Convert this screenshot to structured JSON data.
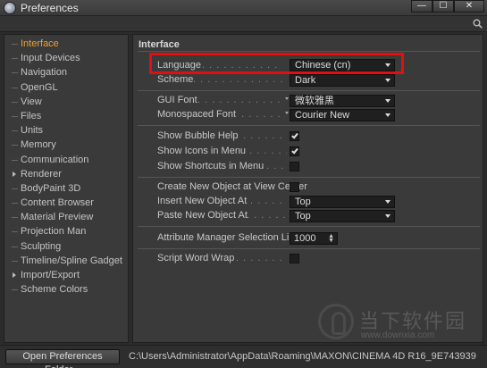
{
  "window": {
    "title": "Preferences",
    "controls": {
      "minimize": "—",
      "maximize": "☐",
      "close": "✕"
    }
  },
  "sidebar": {
    "items": [
      {
        "label": "Interface",
        "active": true,
        "expandable": false
      },
      {
        "label": "Input Devices",
        "active": false,
        "expandable": false
      },
      {
        "label": "Navigation",
        "active": false,
        "expandable": false
      },
      {
        "label": "OpenGL",
        "active": false,
        "expandable": false
      },
      {
        "label": "View",
        "active": false,
        "expandable": false
      },
      {
        "label": "Files",
        "active": false,
        "expandable": false
      },
      {
        "label": "Units",
        "active": false,
        "expandable": false
      },
      {
        "label": "Memory",
        "active": false,
        "expandable": false
      },
      {
        "label": "Communication",
        "active": false,
        "expandable": false
      },
      {
        "label": "Renderer",
        "active": false,
        "expandable": true
      },
      {
        "label": "BodyPaint 3D",
        "active": false,
        "expandable": false
      },
      {
        "label": "Content Browser",
        "active": false,
        "expandable": false
      },
      {
        "label": "Material Preview",
        "active": false,
        "expandable": false
      },
      {
        "label": "Projection Man",
        "active": false,
        "expandable": false
      },
      {
        "label": "Sculpting",
        "active": false,
        "expandable": false
      },
      {
        "label": "Timeline/Spline Gadget",
        "active": false,
        "expandable": false
      },
      {
        "label": "Import/Export",
        "active": false,
        "expandable": true
      },
      {
        "label": "Scheme Colors",
        "active": false,
        "expandable": false
      }
    ]
  },
  "main": {
    "section_title": "Interface",
    "language": {
      "label": "Language",
      "value": "Chinese (cn)"
    },
    "scheme": {
      "label": "Scheme",
      "value": "Dark"
    },
    "gui_font": {
      "label": "GUI Font",
      "value": "微软雅黑"
    },
    "mono_font": {
      "label": "Monospaced Font",
      "value": "Courier New"
    },
    "show_bubble_help": {
      "label": "Show Bubble Help",
      "checked": true
    },
    "show_icons_in_menu": {
      "label": "Show Icons in Menu",
      "checked": true
    },
    "show_shortcuts_in_menu": {
      "label": "Show Shortcuts in Menu",
      "checked": false
    },
    "new_object_at_view_center": {
      "label": "Create New Object at View Center",
      "checked": false
    },
    "insert_new_object_at": {
      "label": "Insert New Object At",
      "value": "Top"
    },
    "paste_new_object_at": {
      "label": "Paste New Object At",
      "value": "Top"
    },
    "attr_manager_limit": {
      "label": "Attribute Manager Selection Limit",
      "value": "1000"
    },
    "script_word_wrap": {
      "label": "Script Word Wrap",
      "checked": false
    }
  },
  "status": {
    "open_folder_label": "Open Preferences Folder...",
    "path": "C:\\Users\\Administrator\\AppData\\Roaming\\MAXON\\CINEMA 4D R16_9E743939"
  },
  "watermark": {
    "title": "当下软件园",
    "url": "www.downxia.com"
  },
  "colors": {
    "accent": "#f0a030",
    "highlight_box": "#e01010",
    "panel": "#3a3a3a",
    "field": "#1f1f1f"
  }
}
